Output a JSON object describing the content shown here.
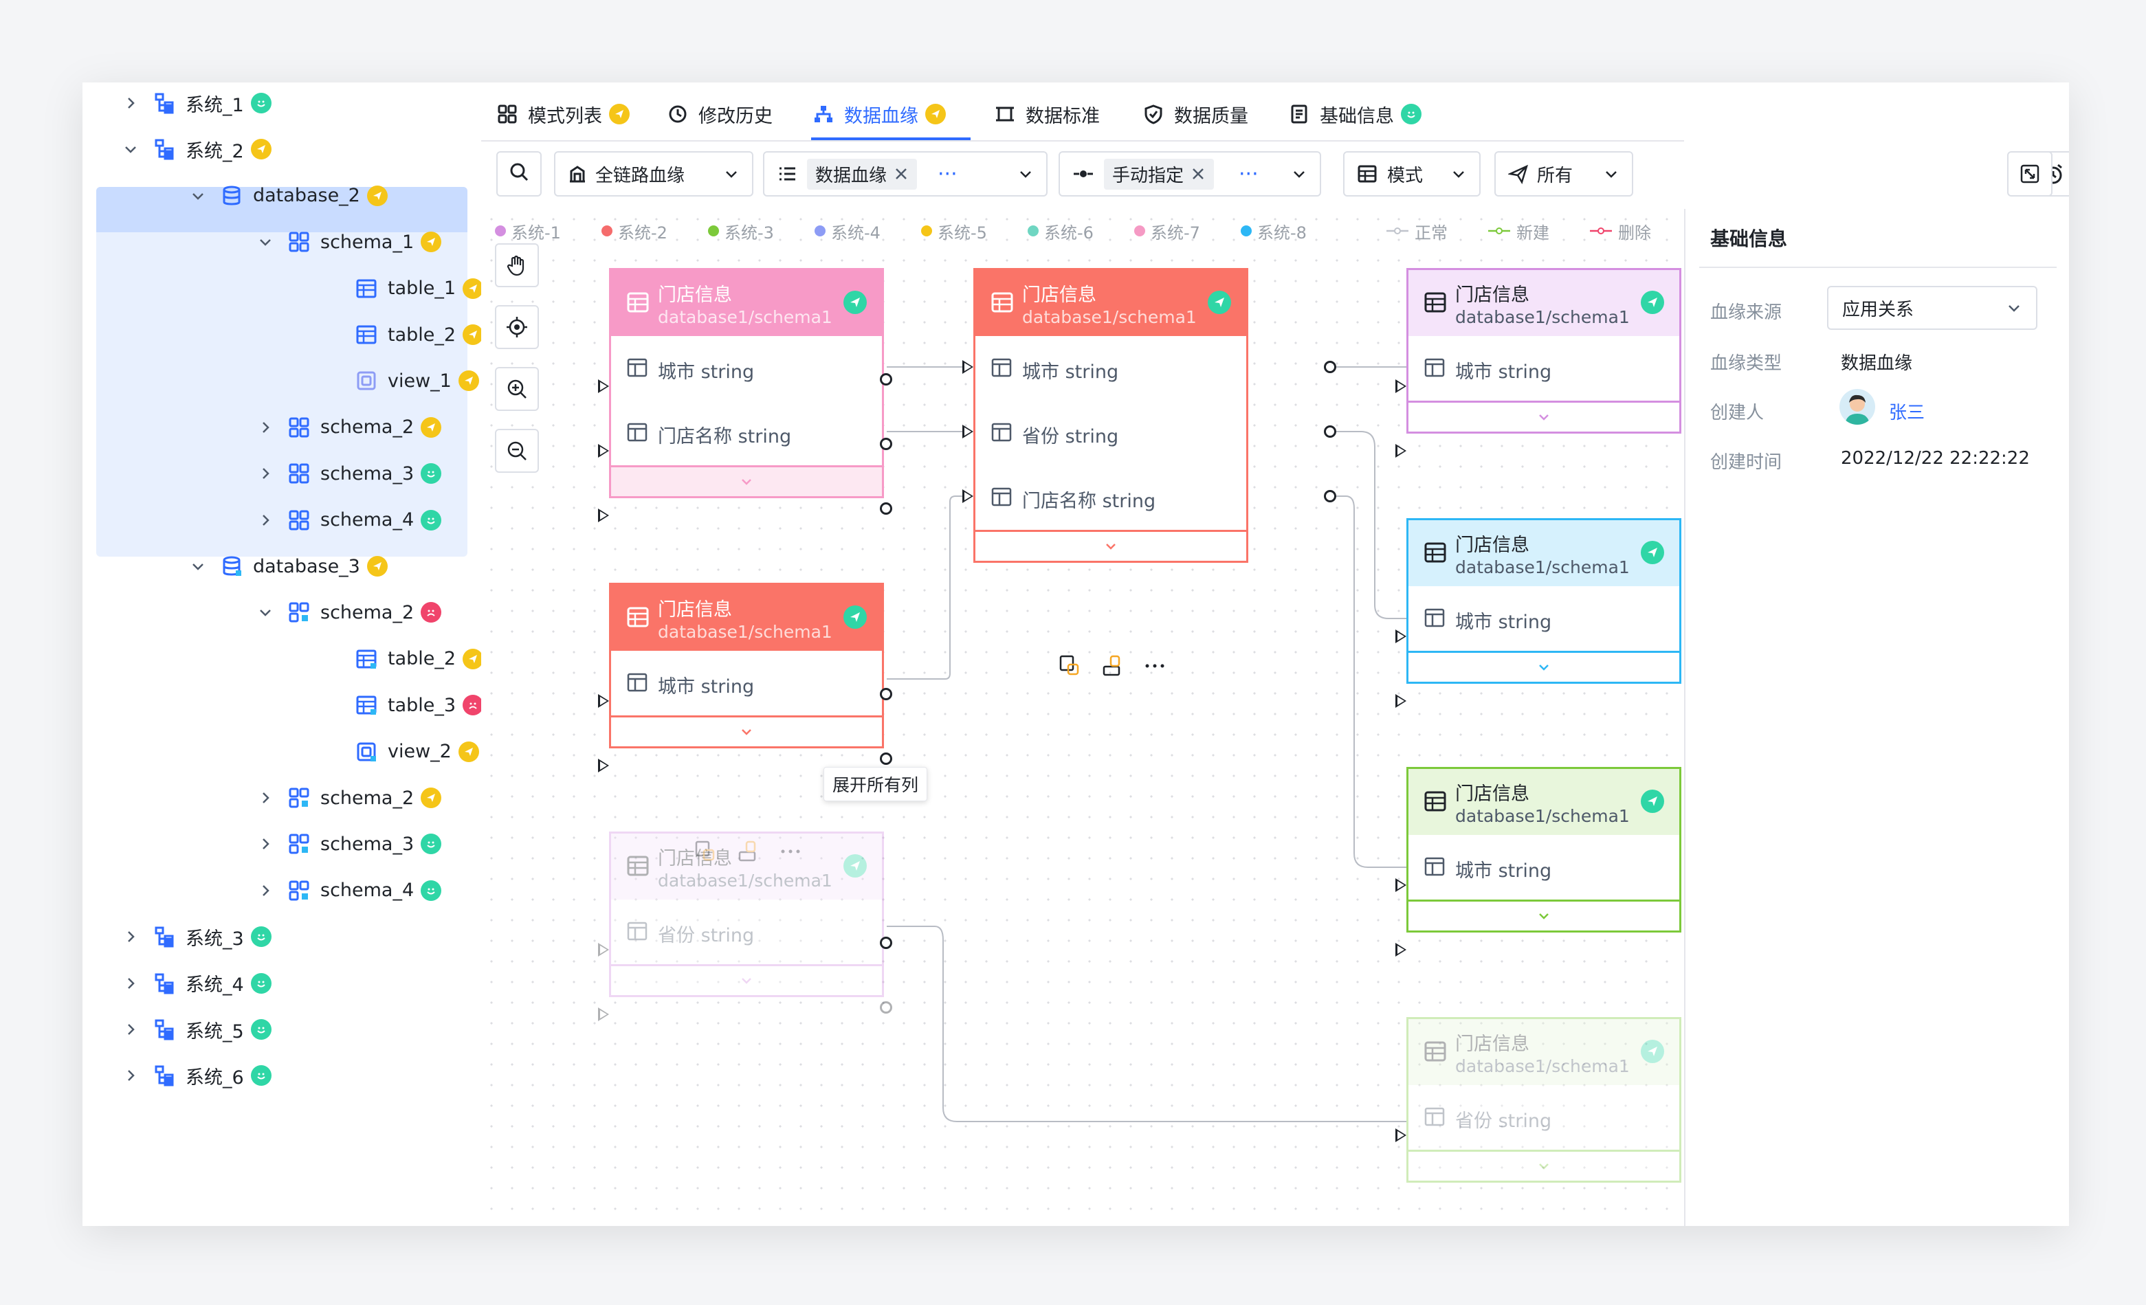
{
  "sidebar": {
    "items": [
      {
        "label": "系统_1",
        "status": "green"
      },
      {
        "label": "系统_2",
        "status": "yellow"
      },
      {
        "label": "database_2",
        "status": "yellow"
      },
      {
        "label": "schema_1",
        "status": "yellow"
      },
      {
        "label": "table_1",
        "status": "yellow"
      },
      {
        "label": "table_2",
        "status": "yellow"
      },
      {
        "label": "view_1",
        "status": "yellow"
      },
      {
        "label": "schema_2",
        "status": "yellow"
      },
      {
        "label": "schema_3",
        "status": "green"
      },
      {
        "label": "schema_4",
        "status": "green"
      },
      {
        "label": "database_3",
        "status": "yellow"
      },
      {
        "label": "schema_2",
        "status": "red"
      },
      {
        "label": "table_2",
        "status": "yellow"
      },
      {
        "label": "table_3",
        "status": "red"
      },
      {
        "label": "view_2",
        "status": "yellow"
      },
      {
        "label": "schema_2",
        "status": "yellow"
      },
      {
        "label": "schema_3",
        "status": "green"
      },
      {
        "label": "schema_4",
        "status": "green"
      },
      {
        "label": "系统_3",
        "status": "green"
      },
      {
        "label": "系统_4",
        "status": "green"
      },
      {
        "label": "系统_5",
        "status": "green"
      },
      {
        "label": "系统_6",
        "status": "green"
      }
    ]
  },
  "tabs": [
    {
      "label": "模式列表",
      "active": false
    },
    {
      "label": "修改历史",
      "active": false
    },
    {
      "label": "数据血缘",
      "active": true
    },
    {
      "label": "数据标准",
      "active": false
    },
    {
      "label": "数据质量",
      "active": false
    },
    {
      "label": "基础信息",
      "active": false
    }
  ],
  "toolbar": {
    "scope": "全链路血缘",
    "type_chip": "数据血缘",
    "mode_chip": "手动指定",
    "more": "···",
    "schema": "模式",
    "all": "所有"
  },
  "legend": {
    "systems": [
      "系统-1",
      "系统-2",
      "系统-3",
      "系统-4",
      "系统-5",
      "系统-6",
      "系统-7",
      "系统-8"
    ],
    "system_colors": [
      "#d48fe0",
      "#f56c6c",
      "#7cc93a",
      "#8d9cf5",
      "#f5c518",
      "#6fd6c2",
      "#f59ac4",
      "#2db7f5"
    ],
    "states": [
      "正常",
      "新建",
      "删除"
    ],
    "state_colors": [
      "#c0c4cc",
      "#7cc93a",
      "#f0446b"
    ]
  },
  "nodes": {
    "title": "门店信息",
    "subtitle": "database1/schema1",
    "field_city": "城市 string",
    "field_store": "门店名称 string",
    "field_province": "省份 string"
  },
  "tooltip": "展开所有列",
  "rightpanel": {
    "title": "基础信息",
    "source_label": "血缘来源",
    "source_value": "应用关系",
    "type_label": "血缘类型",
    "type_value": "数据血缘",
    "creator_label": "创建人",
    "creator_value": "张三",
    "time_label": "创建时间",
    "time_value": "2022/12/22 22:22:22"
  }
}
